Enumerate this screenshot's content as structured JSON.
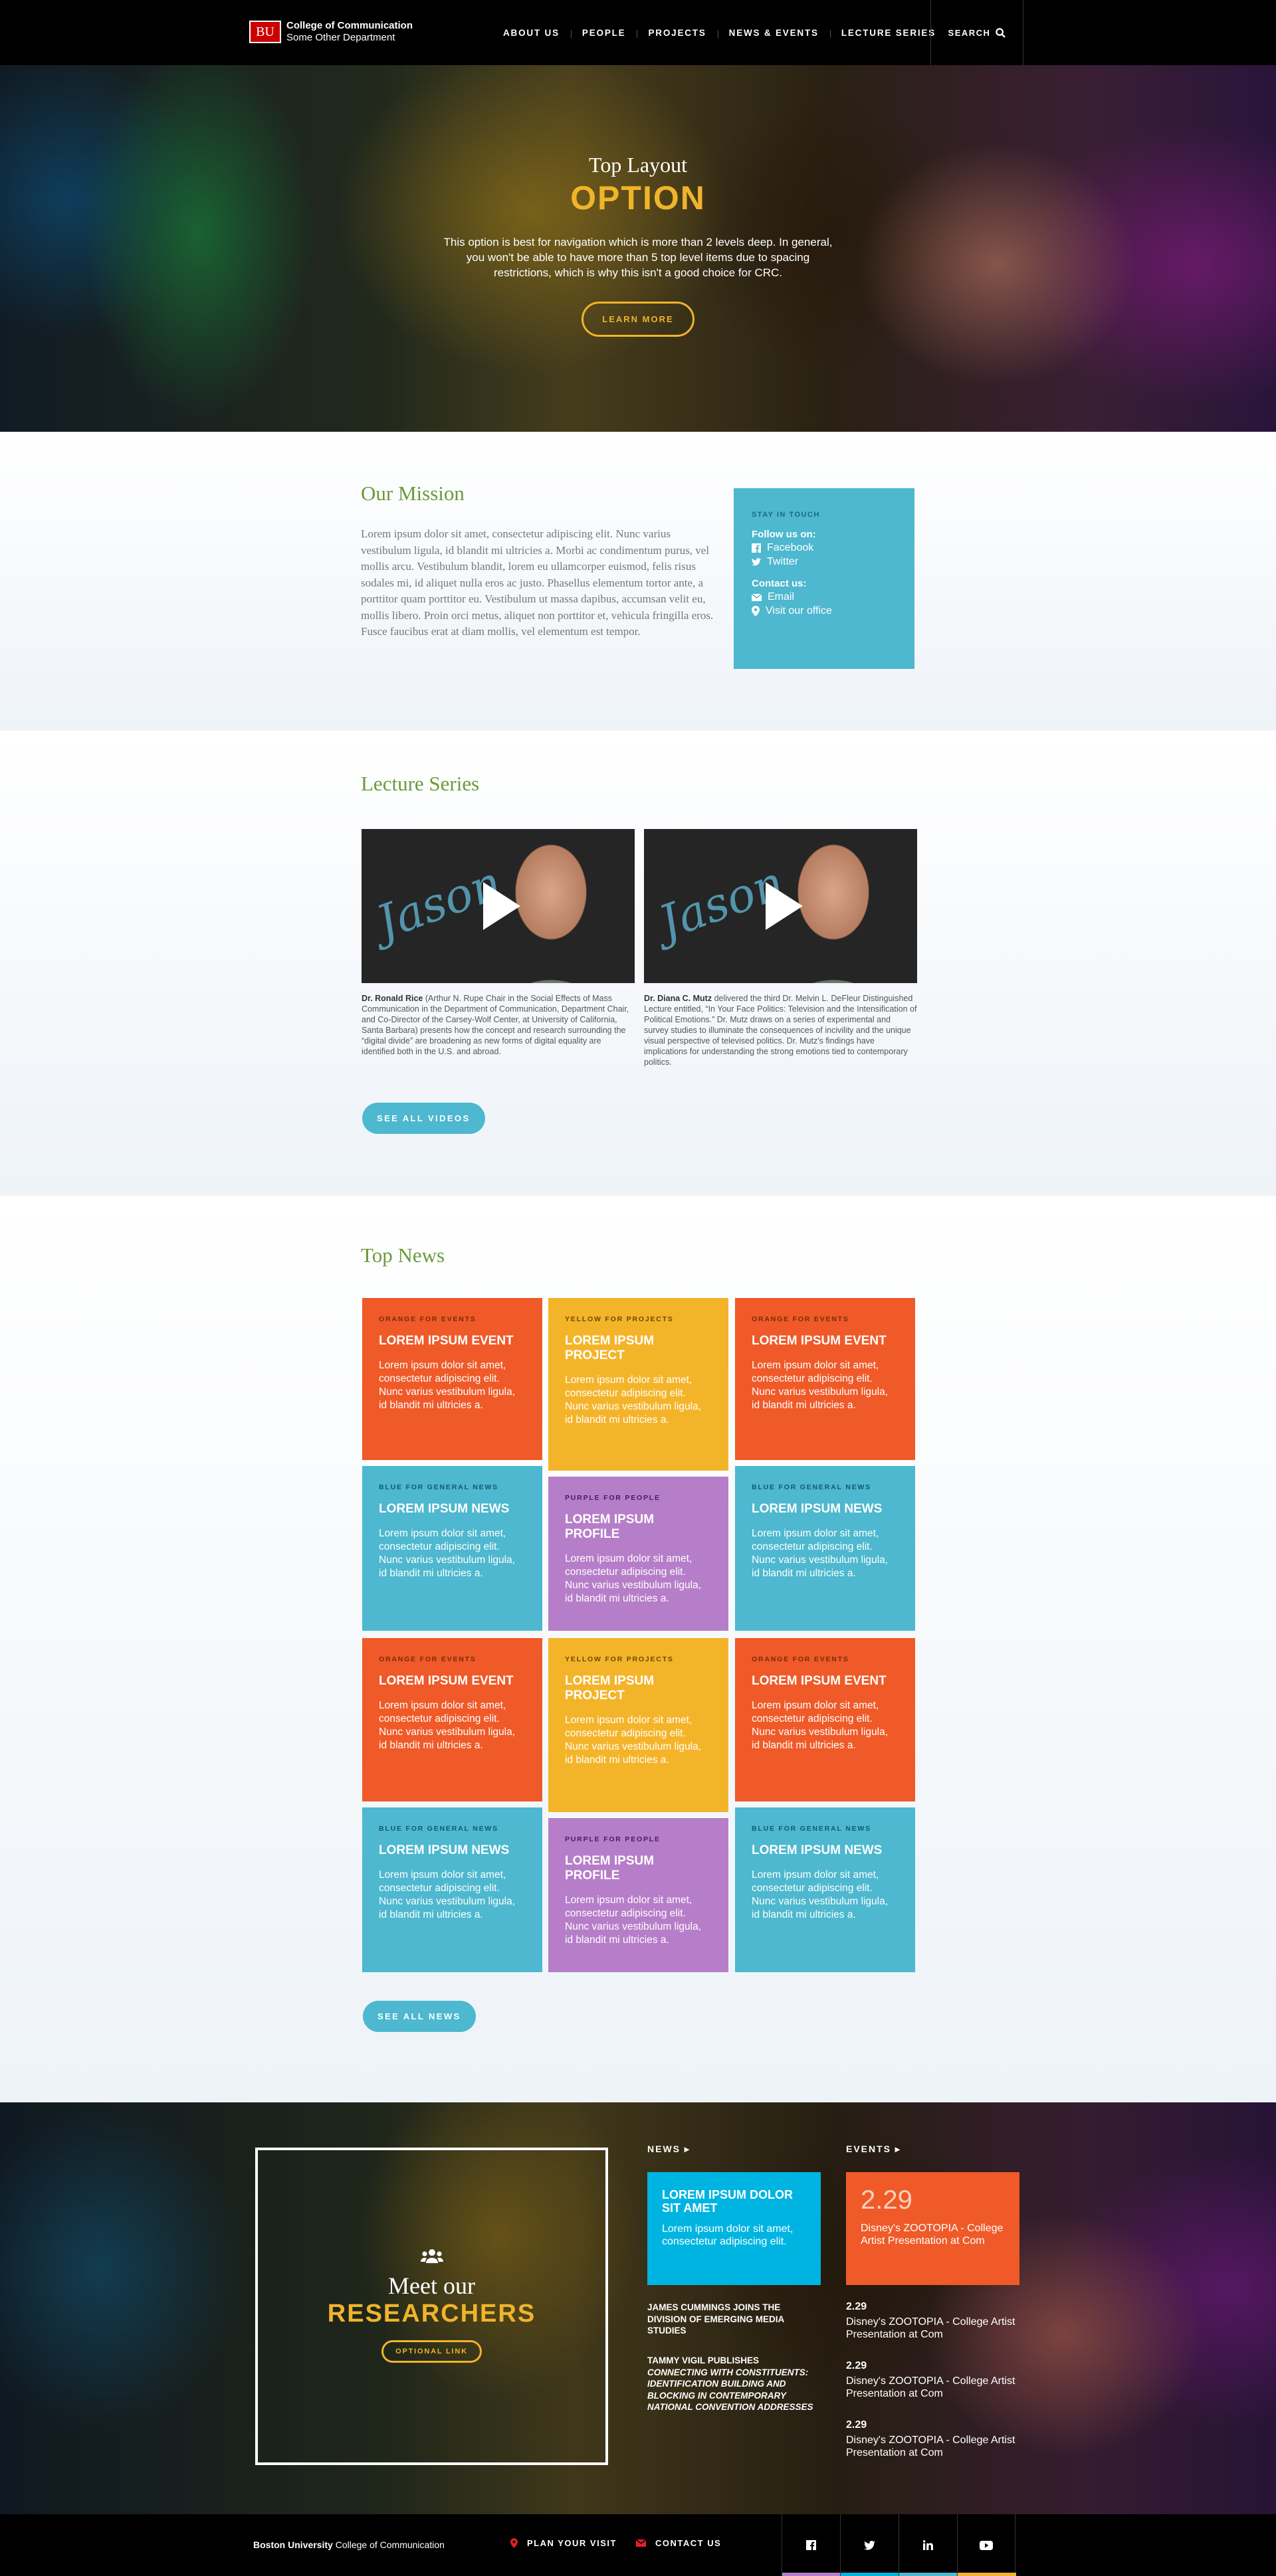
{
  "header": {
    "logo_mark": "BU",
    "college": "College of Communication",
    "department": "Some Other Department",
    "nav": [
      "About Us",
      "People",
      "Projects",
      "News & Events",
      "Lecture Series"
    ],
    "search_label": "SEARCH"
  },
  "hero": {
    "subtitle": "Top Layout",
    "title": "OPTION",
    "text": "This option is best for navigation which is more than 2 levels deep. In general, you won't be able to have more than 5 top level items due to spacing restrictions, which is why this isn't a good choice for CRC.",
    "button": "LEARN MORE"
  },
  "mission": {
    "title": "Our Mission",
    "text": "Lorem ipsum dolor sit amet, consectetur adipiscing elit. Nunc varius vestibulum ligula, id blandit mi ultricies a. Morbi ac condimentum purus, vel mollis arcu. Vestibulum blandit, lorem eu ullamcorper euismod, felis risus sodales mi, id aliquet nulla eros ac justo. Phasellus elementum tortor ante, a porttitor quam porttitor eu. Vestibulum ut massa dapibus, accumsan velit eu, mollis libero. Proin orci metus, aliquet non porttitor et, vehicula fringilla eros. Fusce faucibus erat at diam mollis, vel elementum est tempor.",
    "stay": {
      "heading": "STAY IN TOUCH",
      "follow_label": "Follow us on:",
      "facebook": "Facebook",
      "twitter": "Twitter",
      "contact_label": "Contact us:",
      "email": "Email",
      "office": "Visit our office"
    }
  },
  "lectures": {
    "title": "Lecture Series",
    "scribble": "Jason",
    "videos": [
      {
        "name": "Dr. Ronald Rice",
        "caption": " (Arthur N. Rupe Chair in the Social Effects of Mass Communication in the Department of Communication, Department Chair, and Co-Director of the Carsey-Wolf Center, at University of California, Santa Barbara) presents how the concept and research surrounding the “digital divide” are broadening as new forms of digital equality are identified both in the U.S. and abroad."
      },
      {
        "name": "Dr. Diana C. Mutz",
        "caption": " delivered the third Dr. Melvin L. DeFleur Distinguished Lecture entitled, “In Your Face Politics: Television and the Intensification of Political Emotions.” Dr. Mutz draws on a series of experimental and survey studies to illuminate the consequences of incivility and the unique visual perspective of televised politics. Dr. Mutz's findings have implications for understanding the strong emotions tied to contemporary politics."
      }
    ],
    "button": "SEE ALL VIDEOS"
  },
  "news": {
    "title": "Top News",
    "tiles": [
      {
        "cat": "ORANGE FOR EVENTS",
        "title": "LOREM IPSUM EVENT",
        "body": "Lorem ipsum dolor sit amet, consectetur adipiscing elit. Nunc varius vestibulum ligula, id blandit mi ultricies a."
      },
      {
        "cat": "YELLOW FOR PROJECTS",
        "title": "LOREM IPSUM PROJECT",
        "body": "Lorem ipsum dolor sit amet, consectetur adipiscing elit. Nunc varius vestibulum ligula, id blandit mi ultricies a."
      },
      {
        "cat": "ORANGE FOR EVENTS",
        "title": "LOREM IPSUM EVENT",
        "body": "Lorem ipsum dolor sit amet, consectetur adipiscing elit. Nunc varius vestibulum ligula, id blandit mi ultricies a."
      },
      {
        "cat": "BLUE FOR GENERAL NEWS",
        "title": "LOREM IPSUM NEWS",
        "body": "Lorem ipsum dolor sit amet, consectetur adipiscing elit. Nunc varius vestibulum ligula, id blandit mi ultricies a."
      },
      {
        "cat": "PURPLE FOR PEOPLE",
        "title": "LOREM IPSUM PROFILE",
        "body": "Lorem ipsum dolor sit amet, consectetur adipiscing elit. Nunc varius vestibulum ligula, id blandit mi ultricies a."
      },
      {
        "cat": "BLUE FOR GENERAL NEWS",
        "title": "LOREM IPSUM NEWS",
        "body": "Lorem ipsum dolor sit amet, consectetur adipiscing elit. Nunc varius vestibulum ligula, id blandit mi ultricies a."
      },
      {
        "cat": "ORANGE FOR EVENTS",
        "title": "LOREM IPSUM EVENT",
        "body": "Lorem ipsum dolor sit amet, consectetur adipiscing elit. Nunc varius vestibulum ligula, id blandit mi ultricies a."
      },
      {
        "cat": "YELLOW FOR PROJECTS",
        "title": "LOREM IPSUM PROJECT",
        "body": "Lorem ipsum dolor sit amet, consectetur adipiscing elit. Nunc varius vestibulum ligula, id blandit mi ultricies a."
      },
      {
        "cat": "ORANGE FOR EVENTS",
        "title": "LOREM IPSUM EVENT",
        "body": "Lorem ipsum dolor sit amet, consectetur adipiscing elit. Nunc varius vestibulum ligula, id blandit mi ultricies a."
      },
      {
        "cat": "BLUE FOR GENERAL NEWS",
        "title": "LOREM IPSUM NEWS",
        "body": "Lorem ipsum dolor sit amet, consectetur adipiscing elit. Nunc varius vestibulum ligula, id blandit mi ultricies a."
      },
      {
        "cat": "PURPLE FOR PEOPLE",
        "title": "LOREM IPSUM PROFILE",
        "body": "Lorem ipsum dolor sit amet, consectetur adipiscing elit. Nunc varius vestibulum ligula, id blandit mi ultricies a."
      },
      {
        "cat": "BLUE FOR GENERAL NEWS",
        "title": "LOREM IPSUM NEWS",
        "body": "Lorem ipsum dolor sit amet, consectetur adipiscing elit. Nunc varius vestibulum ligula, id blandit mi ultricies a."
      }
    ],
    "button": "SEE ALL NEWS"
  },
  "researchers": {
    "subtitle": "Meet our",
    "title": "RESEARCHERS",
    "button": "OPTIONAL LINK",
    "news_heading": "NEWS",
    "news_feature": {
      "title": "LOREM IPSUM DOLOR SIT AMET",
      "body": "Lorem ipsum dolor sit amet, consectetur adipiscing elit."
    },
    "news_item_1": "JAMES CUMMINGS JOINS THE DIVISION OF EMERGING MEDIA STUDIES",
    "news_item_2_lead": "TAMMY VIGIL PUBLISHES ",
    "news_item_2_italic": "CONNECTING WITH CONSTITUENTS: IDENTIFICATION BUILDING AND BLOCKING IN CONTEMPORARY NATIONAL CONVENTION ADDRESSES",
    "events_heading": "EVENTS",
    "event_feature": {
      "date": "2.29",
      "title": "Disney's ZOOTOPIA - College Artist Presentation at Com"
    },
    "events": [
      {
        "date": "2.29",
        "title": "Disney's ZOOTOPIA - College Artist Presentation at Com"
      },
      {
        "date": "2.29",
        "title": "Disney's ZOOTOPIA - College Artist Presentation at Com"
      },
      {
        "date": "2.29",
        "title": "Disney's ZOOTOPIA - College Artist Presentation at Com"
      }
    ]
  },
  "footer": {
    "brand_bold": "Boston University",
    "brand_rest": " College of Communication",
    "plan_visit": "PLAN YOUR VISIT",
    "contact": "CONTACT US",
    "social": [
      "facebook-icon",
      "twitter-icon",
      "linkedin-icon",
      "youtube-icon"
    ],
    "social_colors": [
      "#b67ec8",
      "#00b4e2",
      "#4db8cf",
      "#f4b42a"
    ]
  },
  "colors": {
    "orange": "#ef5a28",
    "yellow": "#f4b42a",
    "blue": "#4db8cf",
    "purple": "#b67ec8",
    "green": "#6a9a3a",
    "bu_red": "#cc0000"
  }
}
